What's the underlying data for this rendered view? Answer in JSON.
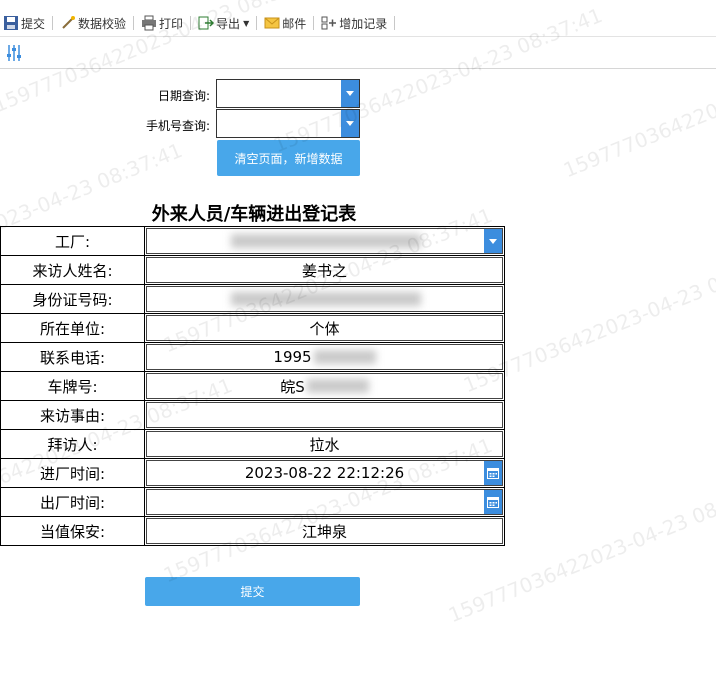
{
  "toolbar": {
    "submit": "提交",
    "validate": "数据校验",
    "print": "打印",
    "export": "导出",
    "mail": "邮件",
    "add_record": "增加记录"
  },
  "query": {
    "date_label": "日期查询:",
    "phone_label": "手机号查询:",
    "clear_button": "清空页面，新增数据"
  },
  "form": {
    "title": "外来人员/车辆进出登记表",
    "rows": [
      {
        "label": "工厂:",
        "value": "",
        "kind": "combo"
      },
      {
        "label": "来访人姓名:",
        "value": "姜书之",
        "kind": "text"
      },
      {
        "label": "身份证号码:",
        "value": "",
        "kind": "text"
      },
      {
        "label": "所在单位:",
        "value": "个体",
        "kind": "text"
      },
      {
        "label": "联系电话:",
        "value": "1995",
        "kind": "text"
      },
      {
        "label": "车牌号:",
        "value": "皖S",
        "kind": "text"
      },
      {
        "label": "来访事由:",
        "value": "",
        "kind": "text"
      },
      {
        "label": "拜访人:",
        "value": "拉水",
        "kind": "text"
      },
      {
        "label": "进厂时间:",
        "value": "2023-08-22 22:12:26",
        "kind": "date"
      },
      {
        "label": "出厂时间:",
        "value": "",
        "kind": "date"
      },
      {
        "label": "当值保安:",
        "value": "江坤泉",
        "kind": "text"
      }
    ],
    "submit_button": "提交"
  },
  "watermark": {
    "text": "159777036422023-04-23 08:37:41"
  }
}
